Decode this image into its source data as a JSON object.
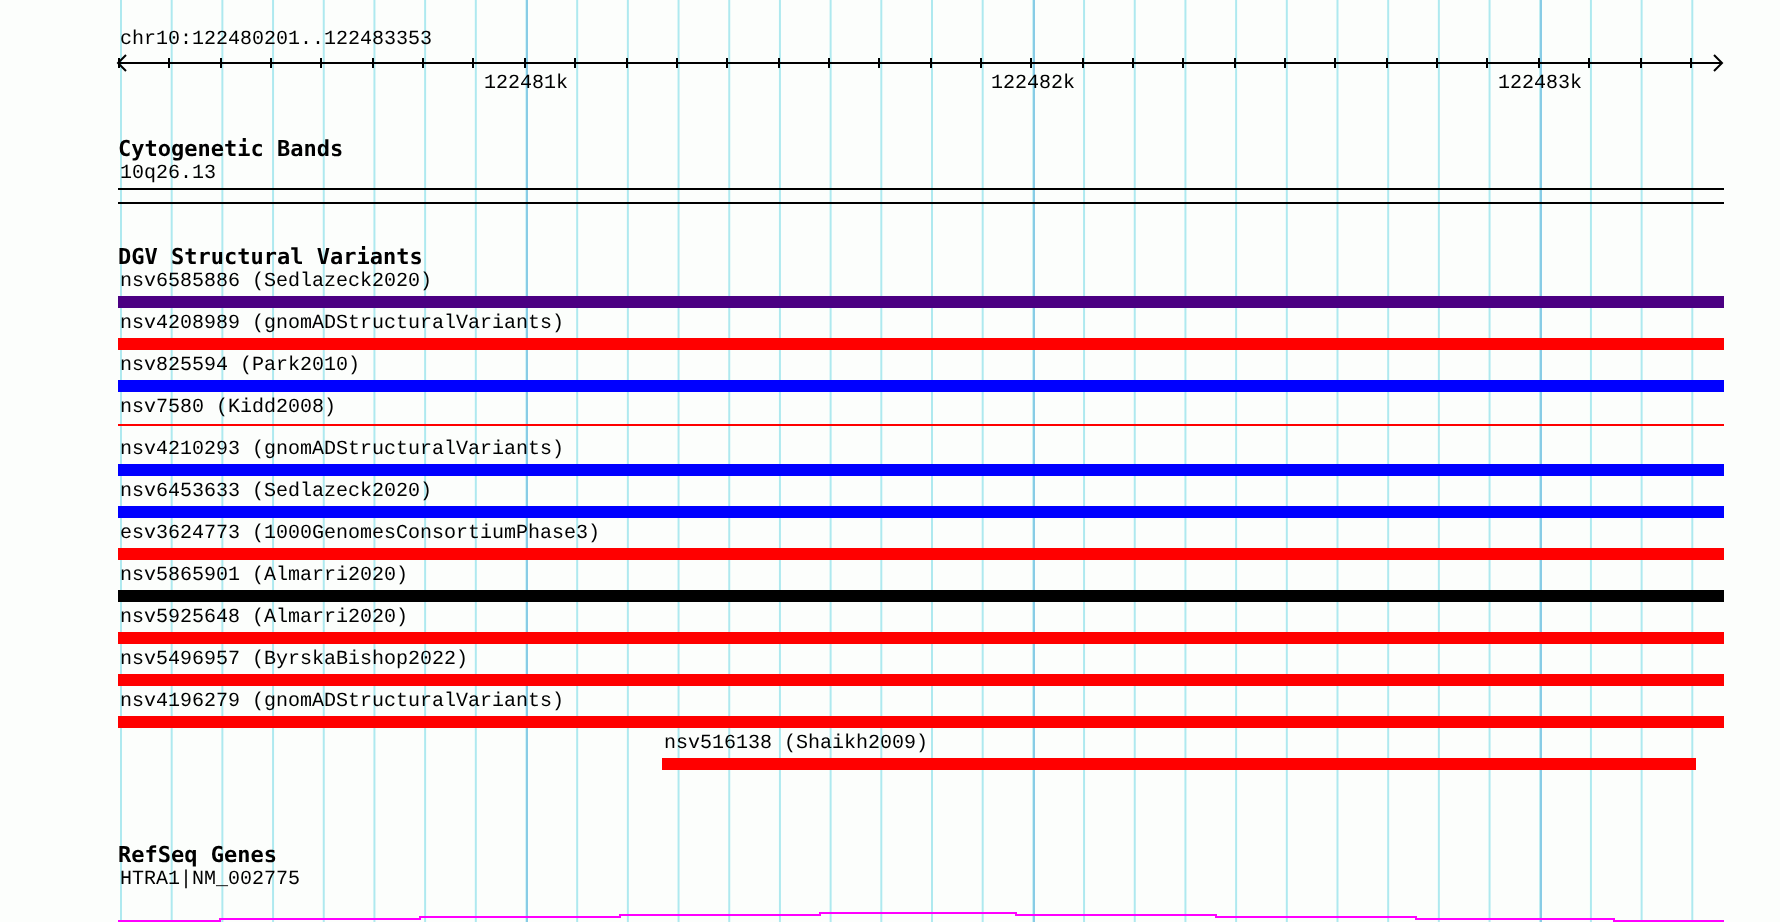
{
  "ruler": {
    "range": "chr10:122480201..122483353",
    "ticks": [
      "122481k",
      "122482k",
      "122483k"
    ]
  },
  "cytogenetic_bands": {
    "title": "Cytogenetic Bands",
    "band": "10q26.13"
  },
  "structural_variants": {
    "title": "DGV Structural Variants",
    "items": [
      {
        "label": "nsv6585886 (Sedlazeck2020)",
        "color": "#4b0082",
        "kind": "bar"
      },
      {
        "label": "nsv4208989 (gnomADStructuralVariants)",
        "color": "#ff0000",
        "kind": "bar"
      },
      {
        "label": "nsv825594 (Park2010)",
        "color": "#0000ff",
        "kind": "bar"
      },
      {
        "label": "nsv7580 (Kidd2008)",
        "color": "#ff0000",
        "kind": "line"
      },
      {
        "label": "nsv4210293 (gnomADStructuralVariants)",
        "color": "#0000ff",
        "kind": "bar"
      },
      {
        "label": "nsv6453633 (Sedlazeck2020)",
        "color": "#0000ff",
        "kind": "bar"
      },
      {
        "label": "esv3624773 (1000GenomesConsortiumPhase3)",
        "color": "#ff0000",
        "kind": "bar"
      },
      {
        "label": "nsv5865901 (Almarri2020)",
        "color": "#000000",
        "kind": "bar"
      },
      {
        "label": "nsv5925648 (Almarri2020)",
        "color": "#ff0000",
        "kind": "bar"
      },
      {
        "label": "nsv5496957 (ByrskaBishop2022)",
        "color": "#ff0000",
        "kind": "bar"
      },
      {
        "label": "nsv4196279 (gnomADStructuralVariants)",
        "color": "#ff0000",
        "kind": "bar"
      },
      {
        "label": "nsv516138 (Shaikh2009)",
        "color": "#ff0000",
        "kind": "inset"
      }
    ]
  },
  "refseq_genes": {
    "title": "RefSeq Genes",
    "gene": "HTRA1|NM_002775"
  }
}
